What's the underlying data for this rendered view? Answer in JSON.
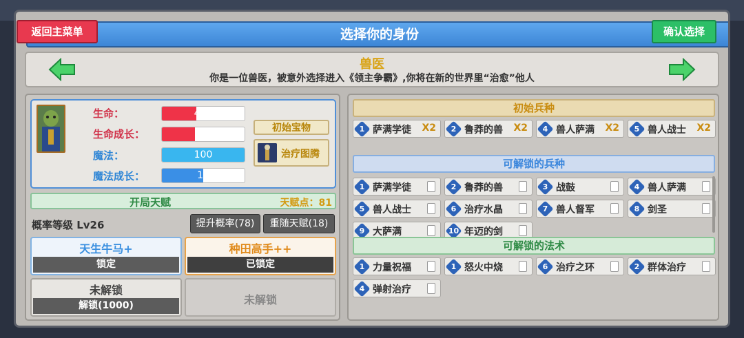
{
  "header": {
    "title": "选择你的身份",
    "back_label": "返回主菜单",
    "confirm_label": "确认选择"
  },
  "role": {
    "name": "兽医",
    "description": "你是一位兽医，被意外选择进入《领主争霸》,你将在新的世界里“治愈”他人"
  },
  "stats": [
    {
      "label": "生命：",
      "value": "400",
      "fill": 0.42,
      "color": "#ef3348",
      "label_color": "#d1334a"
    },
    {
      "label": "生命成长：",
      "value": "40",
      "fill": 0.4,
      "color": "#ef3348",
      "label_color": "#d1334a"
    },
    {
      "label": "魔法：",
      "value": "100",
      "fill": 1.0,
      "color": "#39b6ef",
      "label_color": "#2f86d6"
    },
    {
      "label": "魔法成长：",
      "value": "10",
      "fill": 0.5,
      "color": "#3a8fe6",
      "label_color": "#2f86d6"
    }
  ],
  "treasure": {
    "header": "初始宝物",
    "item": "治疗图腾"
  },
  "talent": {
    "title": "开局天赋",
    "points": "天赋点：81"
  },
  "rate": {
    "level_text": "概率等级 Lv26",
    "boost_label": "提升概率(78)",
    "reroll_label": "重随天赋(18)"
  },
  "talent_cards": [
    {
      "title": "天生牛马+",
      "action": "锁定"
    },
    {
      "title": "种田高手++",
      "action": "已锁定"
    },
    {
      "title": "未解锁",
      "action": "解锁(1000)"
    },
    {
      "title": "未解锁",
      "action": ""
    }
  ],
  "initial_units": {
    "title": "初始兵种",
    "items": [
      {
        "tier": "1",
        "name": "萨满学徒",
        "count": "X2"
      },
      {
        "tier": "2",
        "name": "鲁莽的兽",
        "count": "X2"
      },
      {
        "tier": "4",
        "name": "兽人萨满",
        "count": "X2"
      },
      {
        "tier": "5",
        "name": "兽人战士",
        "count": "X2"
      }
    ]
  },
  "unlockable_units": {
    "title": "可解锁的兵种",
    "items": [
      {
        "tier": "1",
        "name": "萨满学徒"
      },
      {
        "tier": "2",
        "name": "鲁莽的兽"
      },
      {
        "tier": "3",
        "name": "战鼓"
      },
      {
        "tier": "4",
        "name": "兽人萨满"
      },
      {
        "tier": "5",
        "name": "兽人战士"
      },
      {
        "tier": "6",
        "name": "治疗水晶"
      },
      {
        "tier": "7",
        "name": "兽人督军"
      },
      {
        "tier": "8",
        "name": "剑圣"
      },
      {
        "tier": "9",
        "name": "大萨满"
      },
      {
        "tier": "10",
        "name": "年迈的剑"
      }
    ]
  },
  "unlockable_spells": {
    "title": "可解锁的法术",
    "items": [
      {
        "tier": "1",
        "name": "力量祝福"
      },
      {
        "tier": "1",
        "name": "怒火中烧"
      },
      {
        "tier": "6",
        "name": "治疗之环"
      },
      {
        "tier": "2",
        "name": "群体治疗"
      },
      {
        "tier": "4",
        "name": "弹射治疗"
      }
    ]
  }
}
